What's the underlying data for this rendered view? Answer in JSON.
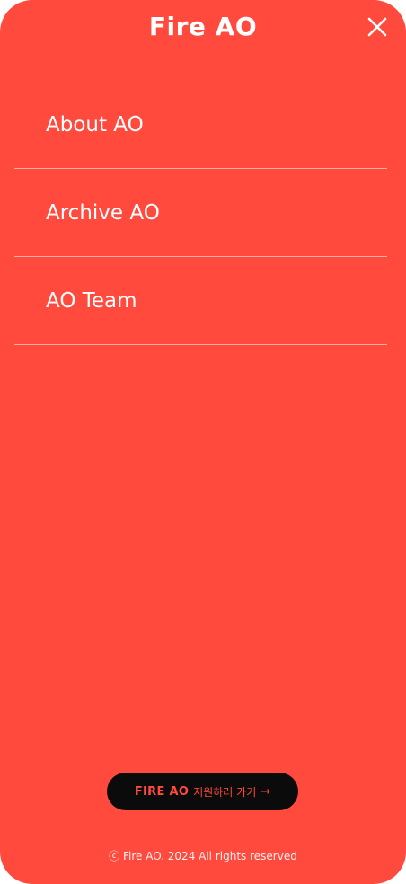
{
  "header": {
    "logo": "Fire AO",
    "close_icon": "close-icon"
  },
  "menu": {
    "items": [
      {
        "label": "About AO"
      },
      {
        "label": "Archive AO"
      },
      {
        "label": "AO Team"
      }
    ]
  },
  "apply_button": {
    "brand": "FIRE AO",
    "label": "지원하러 가기",
    "arrow": "→"
  },
  "footer": {
    "copyright": "ⓒ Fire AO. 2024 All rights reserved"
  },
  "colors": {
    "background": "#ff4a3d",
    "button": "#0b0b0b",
    "text": "#ffffff"
  }
}
